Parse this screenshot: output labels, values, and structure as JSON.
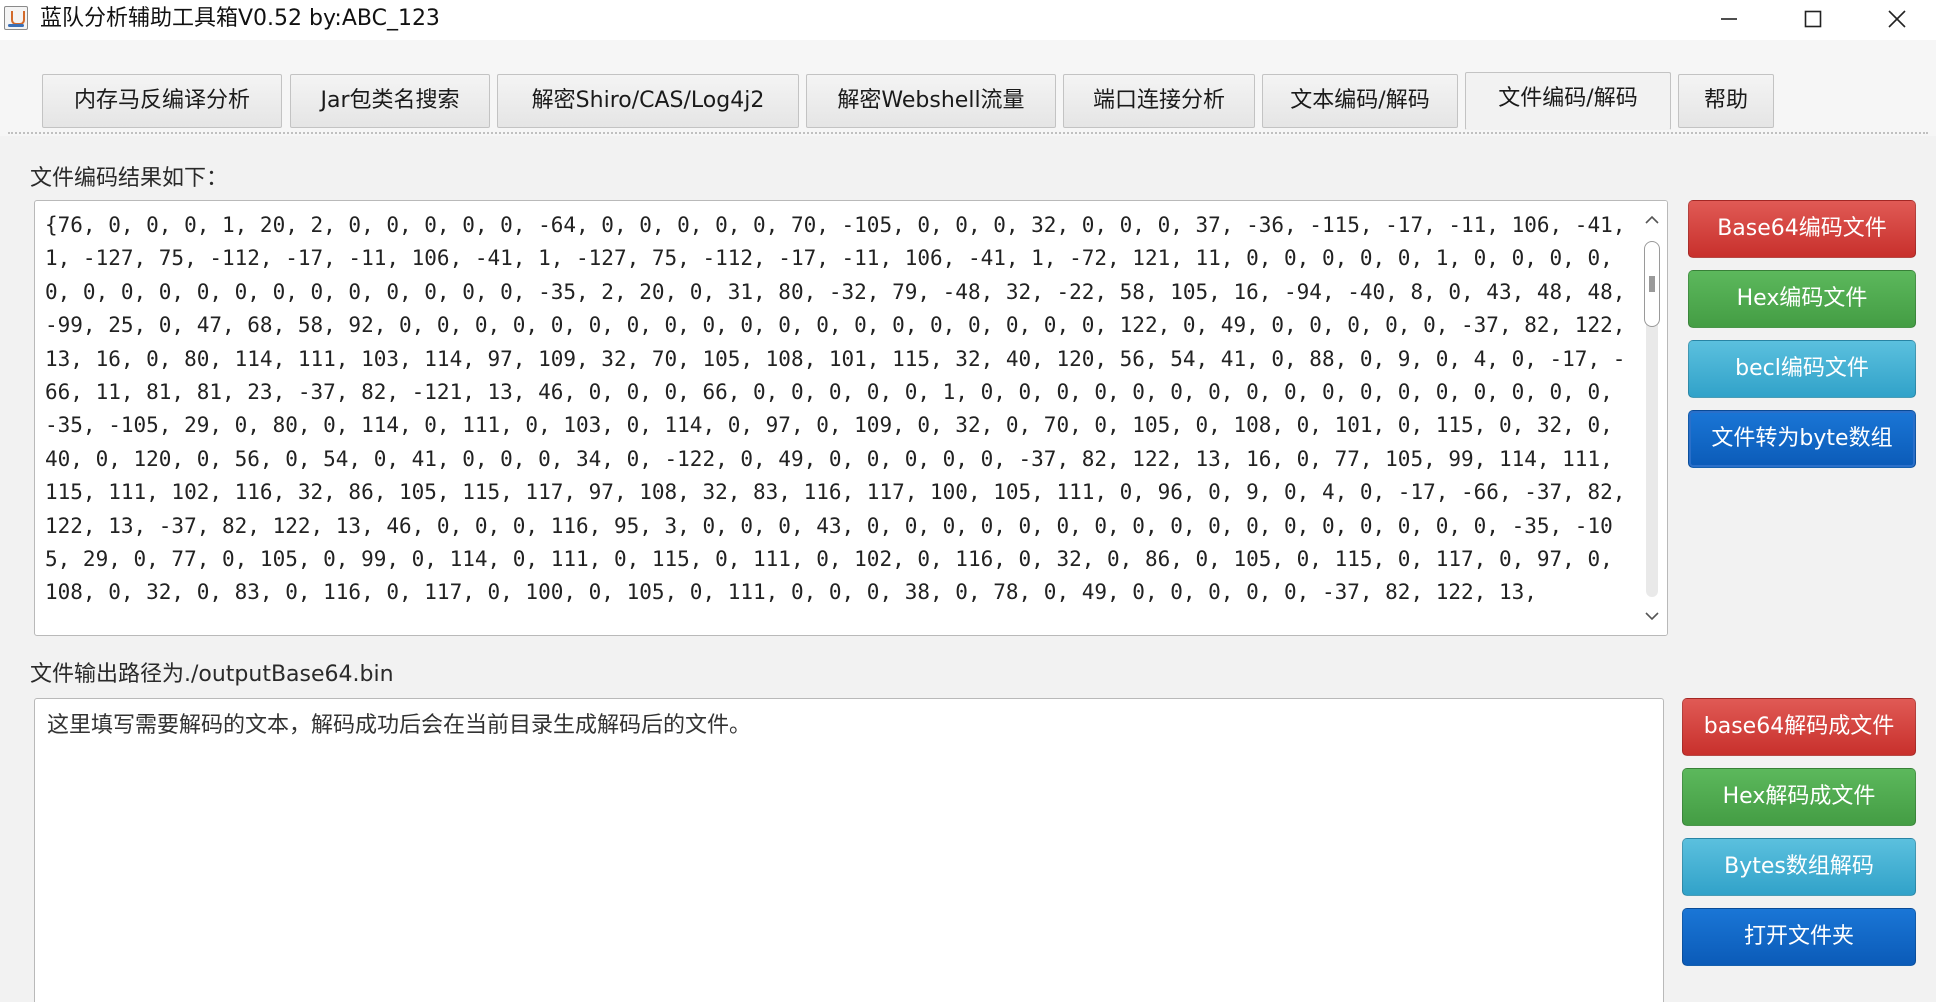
{
  "window": {
    "title": "蓝队分析辅助工具箱V0.52 by:ABC_123"
  },
  "tabs": [
    {
      "label": "内存马反编译分析"
    },
    {
      "label": "Jar包类名搜索"
    },
    {
      "label": "解密Shiro/CAS/Log4j2"
    },
    {
      "label": "解密Webshell流量"
    },
    {
      "label": "端口连接分析"
    },
    {
      "label": "文本编码/解码"
    },
    {
      "label": "文件编码/解码"
    },
    {
      "label": "帮助"
    }
  ],
  "active_tab": "文件编码/解码",
  "encode_section": {
    "label": "文件编码结果如下：",
    "result_text": "{76, 0, 0, 0, 1, 20, 2, 0, 0, 0, 0, 0, -64, 0, 0, 0, 0, 0, 70, -105, 0, 0, 0, 32, 0, 0, 0, 37, -36, -115, -17, -11, 106, -41, 1, -127, 75, -112, -17, -11, 106, -41, 1, -127, 75, -112, -17, -11, 106, -41, 1, -72, 121, 11, 0, 0, 0, 0, 0, 1, 0, 0, 0, 0, 0, 0, 0, 0, 0, 0, 0, 0, 0, 0, 0, 0, 0, -35, 2, 20, 0, 31, 80, -32, 79, -48, 32, -22, 58, 105, 16, -94, -40, 8, 0, 43, 48, 48, -99, 25, 0, 47, 68, 58, 92, 0, 0, 0, 0, 0, 0, 0, 0, 0, 0, 0, 0, 0, 0, 0, 0, 0, 0, 0, 122, 0, 49, 0, 0, 0, 0, 0, -37, 82, 122, 13, 16, 0, 80, 114, 111, 103, 114, 97, 109, 32, 70, 105, 108, 101, 115, 32, 40, 120, 56, 54, 41, 0, 88, 0, 9, 0, 4, 0, -17, -66, 11, 81, 81, 23, -37, 82, -121, 13, 46, 0, 0, 0, 66, 0, 0, 0, 0, 0, 1, 0, 0, 0, 0, 0, 0, 0, 0, 0, 0, 0, 0, 0, 0, 0, 0, 0, -35, -105, 29, 0, 80, 0, 114, 0, 111, 0, 103, 0, 114, 0, 97, 0, 109, 0, 32, 0, 70, 0, 105, 0, 108, 0, 101, 0, 115, 0, 32, 0, 40, 0, 120, 0, 56, 0, 54, 0, 41, 0, 0, 0, 34, 0, -122, 0, 49, 0, 0, 0, 0, 0, -37, 82, 122, 13, 16, 0, 77, 105, 99, 114, 111, 115, 111, 102, 116, 32, 86, 105, 115, 117, 97, 108, 32, 83, 116, 117, 100, 105, 111, 0, 96, 0, 9, 0, 4, 0, -17, -66, -37, 82, 122, 13, -37, 82, 122, 13, 46, 0, 0, 0, 116, 95, 3, 0, 0, 0, 43, 0, 0, 0, 0, 0, 0, 0, 0, 0, 0, 0, 0, 0, 0, 0, 0, 0, -35, -105, 29, 0, 77, 0, 105, 0, 99, 0, 114, 0, 111, 0, 115, 0, 111, 0, 102, 0, 116, 0, 32, 0, 86, 0, 105, 0, 115, 0, 117, 0, 97, 0, 108, 0, 32, 0, 83, 0, 116, 0, 117, 0, 100, 0, 105, 0, 111, 0, 0, 0, 38, 0, 78, 0, 49, 0, 0, 0, 0, 0, -37, 82, 122, 13,"
  },
  "encode_buttons": {
    "base64": "Base64编码文件",
    "hex": "Hex编码文件",
    "bcel": "becl编码文件",
    "to_bytes": "文件转为byte数组"
  },
  "output_path_label": "文件输出路径为./outputBase64.bin",
  "decode_section": {
    "input_value": "这里填写需要解码的文本，解码成功后会在当前目录生成解码后的文件。"
  },
  "decode_buttons": {
    "base64": "base64解码成文件",
    "hex": "Hex解码成文件",
    "bytes": "Bytes数组解码",
    "open_folder": "打开文件夹"
  },
  "colors": {
    "red": "#d9534f",
    "green": "#5cb85c",
    "cyan": "#5bc0de",
    "blue": "#0b6ac8"
  },
  "icons": {
    "app": "java-cup-icon",
    "minimize": "minimize-icon",
    "maximize": "maximize-icon",
    "close": "close-icon",
    "scroll_up": "chevron-up-icon",
    "scroll_down": "chevron-down-icon"
  }
}
